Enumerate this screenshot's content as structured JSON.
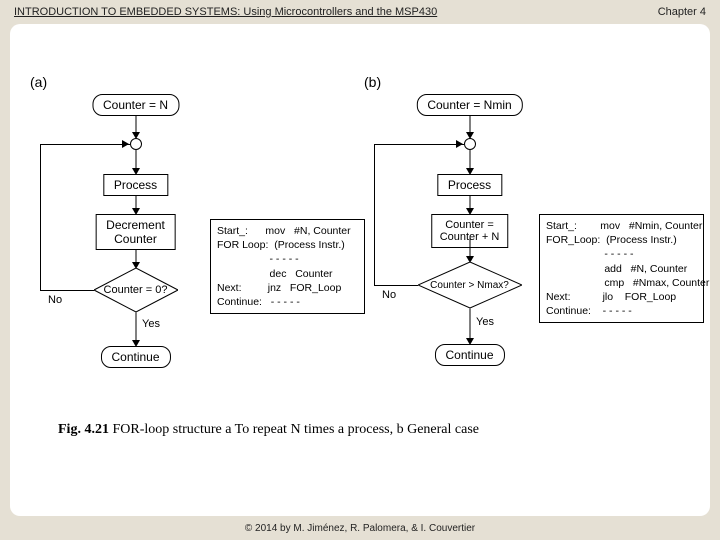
{
  "header": {
    "title": "INTRODUCTION TO EMBEDDED SYSTEMS: Using Microcontrollers and the MSP430",
    "chapter": "Chapter 4"
  },
  "footer": {
    "text": "© 2014 by M. Jiménez, R. Palomera, & I. Couvertier"
  },
  "fig": {
    "a": {
      "label": "(a)",
      "init": "Counter = N",
      "process": "Process",
      "decr": "Decrement\nCounter",
      "cond": "Counter = 0?",
      "no": "No",
      "yes": "Yes",
      "cont": "Continue",
      "code": "Start_:      mov   #N, Counter\nFOR Loop:  (Process Instr.)\n                  - - - - -\n                  dec   Counter\nNext:         jnz   FOR_Loop\nContinue:   - - - - -"
    },
    "b": {
      "label": "(b)",
      "init": "Counter = Nmin",
      "process": "Process",
      "incr": "Counter = Counter + N",
      "cond": "Counter > Nmax?",
      "no": "No",
      "yes": "Yes",
      "cont": "Continue",
      "code": "Start_:        mov   #Nmin, Counter\nFOR_Loop:  (Process Instr.)\n                    - - - - -\n                    add   #N, Counter\n                    cmp   #Nmax, Counter\nNext:           jlo    FOR_Loop\nContinue:    - - - - -"
    },
    "caption_bold": "Fig. 4.21",
    "caption_rest": " FOR-loop structure a To repeat N times a process, b General case"
  }
}
